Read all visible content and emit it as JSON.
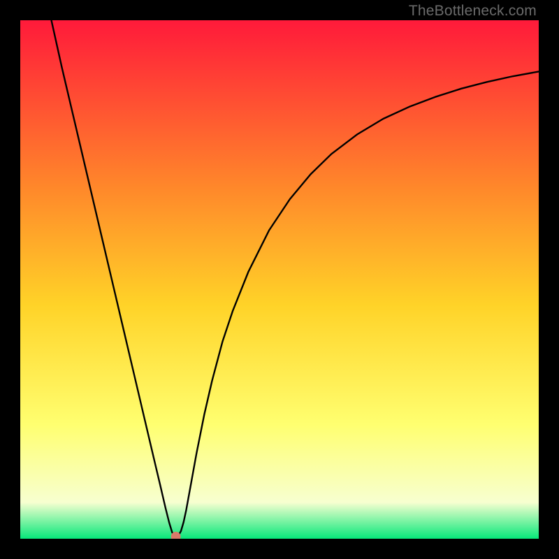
{
  "watermark": "TheBottleneck.com",
  "chart_data": {
    "type": "line",
    "title": "",
    "xlabel": "",
    "ylabel": "",
    "xlim": [
      0,
      100
    ],
    "ylim": [
      0,
      100
    ],
    "grid": false,
    "legend": false,
    "background_gradient": {
      "top_color": "#ff1a3a",
      "mid_upper_color": "#ff8a2a",
      "mid_color": "#ffd328",
      "mid_lower_color": "#ffff70",
      "low_color": "#f7ffd0",
      "bottom_color": "#07e87a"
    },
    "series": [
      {
        "name": "bottleneck-curve",
        "color": "#000000",
        "x": [
          6,
          8,
          10,
          12,
          14,
          16,
          18,
          20,
          22,
          24,
          26,
          27,
          28,
          28.7,
          29.3,
          30,
          30.5,
          31,
          31.5,
          32,
          33,
          34,
          35.5,
          37,
          39,
          41,
          44,
          48,
          52,
          56,
          60,
          65,
          70,
          75,
          80,
          85,
          90,
          95,
          100
        ],
        "y": [
          100,
          91,
          82.5,
          74,
          65.5,
          57,
          48.5,
          40,
          31.5,
          23,
          14.5,
          10.3,
          6,
          3.2,
          1.2,
          0.4,
          0.6,
          1.5,
          3.2,
          5.5,
          11,
          16.5,
          24,
          30.5,
          38,
          44,
          51.5,
          59.5,
          65.5,
          70.3,
          74.2,
          78,
          81,
          83.3,
          85.2,
          86.8,
          88.1,
          89.2,
          90.1
        ]
      }
    ],
    "marker": {
      "name": "optimum-dot",
      "x": 30,
      "y": 0.4,
      "color": "#d97a6a",
      "radius_px": 7
    }
  }
}
